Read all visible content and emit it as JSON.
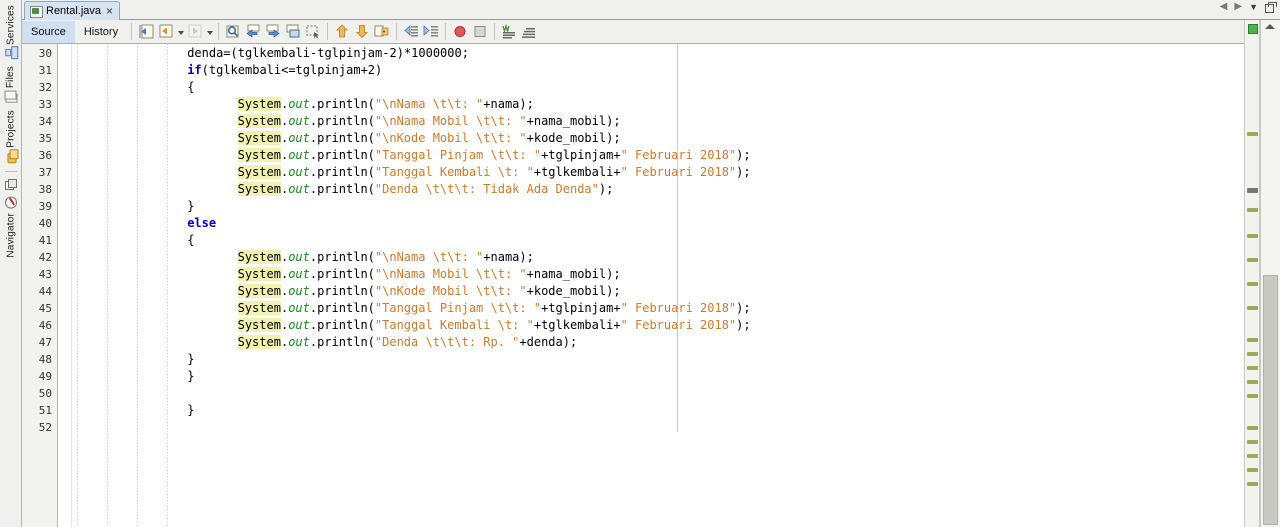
{
  "window": {
    "tab_label": "Rental.java",
    "tab_icon": "java-file-icon",
    "close_label": "×"
  },
  "tabnav": {
    "prev": "◀",
    "next": "▶",
    "list": "▼",
    "maximize_name": "maximize-button"
  },
  "editor_tabs": [
    {
      "label": "Source",
      "active": true
    },
    {
      "label": "History",
      "active": false
    }
  ],
  "toolbar": {
    "buttons": [
      {
        "name": "last-edit-button",
        "icon": "back-edit-icon"
      },
      {
        "name": "go-back-button",
        "icon": "navigate-back-icon"
      },
      {
        "name": "go-forward-button",
        "icon": "navigate-forward-icon"
      },
      {
        "name": "find-selection-button",
        "icon": "magnifier-icon"
      },
      {
        "name": "find-previous-button",
        "icon": "arrow-left-blue-icon"
      },
      {
        "name": "find-next-button",
        "icon": "arrow-right-blue-icon"
      },
      {
        "name": "toggle-highlight-button",
        "icon": "highlight-search-icon"
      },
      {
        "name": "toggle-rectangular-selection-button",
        "icon": "rect-select-icon"
      },
      {
        "name": "previous-bookmark-button",
        "icon": "arrow-up-orange-icon"
      },
      {
        "name": "next-bookmark-button",
        "icon": "arrow-down-orange-icon"
      },
      {
        "name": "toggle-bookmark-button",
        "icon": "bookmark-tag-icon"
      },
      {
        "name": "shift-left-button",
        "icon": "shift-line-left-icon"
      },
      {
        "name": "shift-right-button",
        "icon": "shift-line-right-icon"
      },
      {
        "name": "toggle-breakpoint-button",
        "icon": "red-circle-icon"
      },
      {
        "name": "stop-button",
        "icon": "stop-square-icon"
      },
      {
        "name": "inspect-button",
        "icon": "green-bars-icon"
      },
      {
        "name": "comment-button",
        "icon": "gray-bars-icon"
      }
    ]
  },
  "sidebar": {
    "items": [
      {
        "label": "Services",
        "icon": "services-icon"
      },
      {
        "label": "Files",
        "icon": "files-icon"
      },
      {
        "label": "Projects",
        "icon": "projects-icon"
      },
      {
        "label": "Navigator",
        "icon": "navigator-compass-icon"
      }
    ]
  },
  "editor": {
    "first_line": 30,
    "last_line": 52,
    "margin_column": 80,
    "line_numbers": [
      30,
      31,
      32,
      33,
      34,
      35,
      36,
      37,
      38,
      39,
      40,
      41,
      42,
      43,
      44,
      45,
      46,
      47,
      48,
      49,
      50,
      51,
      52
    ],
    "code_lines": [
      {
        "n": 30,
        "indent": 16,
        "parts": [
          {
            "t": "denda=(tglkembali-tglpinjam-2)*1000000;",
            "c": "plain"
          }
        ]
      },
      {
        "n": 31,
        "indent": 16,
        "parts": [
          {
            "t": "if",
            "c": "kw"
          },
          {
            "t": "(tglkembali<=tglpinjam+2)",
            "c": "plain"
          }
        ]
      },
      {
        "n": 32,
        "indent": 16,
        "parts": [
          {
            "t": "{",
            "c": "plain"
          }
        ]
      },
      {
        "n": 33,
        "indent": 23,
        "parts": [
          {
            "t": "System",
            "c": "sys"
          },
          {
            "t": ".",
            "c": "plain"
          },
          {
            "t": "out",
            "c": "out"
          },
          {
            "t": ".println(",
            "c": "plain"
          },
          {
            "t": "\"\\nNama \\t\\t: \"",
            "c": "str"
          },
          {
            "t": "+nama);",
            "c": "plain"
          }
        ]
      },
      {
        "n": 34,
        "indent": 23,
        "parts": [
          {
            "t": "System",
            "c": "sys"
          },
          {
            "t": ".",
            "c": "plain"
          },
          {
            "t": "out",
            "c": "out"
          },
          {
            "t": ".println(",
            "c": "plain"
          },
          {
            "t": "\"\\nNama Mobil \\t\\t: \"",
            "c": "str"
          },
          {
            "t": "+nama_mobil);",
            "c": "plain"
          }
        ]
      },
      {
        "n": 35,
        "indent": 23,
        "parts": [
          {
            "t": "System",
            "c": "sys"
          },
          {
            "t": ".",
            "c": "plain"
          },
          {
            "t": "out",
            "c": "out"
          },
          {
            "t": ".println(",
            "c": "plain"
          },
          {
            "t": "\"\\nKode Mobil \\t\\t: \"",
            "c": "str"
          },
          {
            "t": "+kode_mobil);",
            "c": "plain"
          }
        ]
      },
      {
        "n": 36,
        "indent": 23,
        "parts": [
          {
            "t": "System",
            "c": "sys"
          },
          {
            "t": ".",
            "c": "plain"
          },
          {
            "t": "out",
            "c": "out"
          },
          {
            "t": ".println(",
            "c": "plain"
          },
          {
            "t": "\"Tanggal Pinjam \\t\\t: \"",
            "c": "str"
          },
          {
            "t": "+tglpinjam+",
            "c": "plain"
          },
          {
            "t": "\" Februari 2018\"",
            "c": "str"
          },
          {
            "t": ");",
            "c": "plain"
          }
        ]
      },
      {
        "n": 37,
        "indent": 23,
        "parts": [
          {
            "t": "System",
            "c": "sys"
          },
          {
            "t": ".",
            "c": "plain"
          },
          {
            "t": "out",
            "c": "out"
          },
          {
            "t": ".println(",
            "c": "plain"
          },
          {
            "t": "\"Tanggal Kembali \\t: \"",
            "c": "str"
          },
          {
            "t": "+tglkembali+",
            "c": "plain"
          },
          {
            "t": "\" Februari 2018\"",
            "c": "str"
          },
          {
            "t": ");",
            "c": "plain"
          }
        ]
      },
      {
        "n": 38,
        "indent": 23,
        "parts": [
          {
            "t": "System",
            "c": "sys"
          },
          {
            "t": ".",
            "c": "plain"
          },
          {
            "t": "out",
            "c": "out"
          },
          {
            "t": ".println(",
            "c": "plain"
          },
          {
            "t": "\"Denda \\t\\t\\t: Tidak Ada Denda\"",
            "c": "str"
          },
          {
            "t": ");",
            "c": "plain"
          }
        ]
      },
      {
        "n": 39,
        "indent": 16,
        "parts": [
          {
            "t": "}",
            "c": "plain"
          }
        ]
      },
      {
        "n": 40,
        "indent": 16,
        "parts": [
          {
            "t": "else",
            "c": "kw"
          }
        ]
      },
      {
        "n": 41,
        "indent": 16,
        "parts": [
          {
            "t": "{",
            "c": "plain"
          }
        ]
      },
      {
        "n": 42,
        "indent": 23,
        "parts": [
          {
            "t": "System",
            "c": "sys"
          },
          {
            "t": ".",
            "c": "plain"
          },
          {
            "t": "out",
            "c": "out"
          },
          {
            "t": ".println(",
            "c": "plain"
          },
          {
            "t": "\"\\nNama \\t\\t: \"",
            "c": "str"
          },
          {
            "t": "+nama);",
            "c": "plain"
          }
        ]
      },
      {
        "n": 43,
        "indent": 23,
        "parts": [
          {
            "t": "System",
            "c": "sys"
          },
          {
            "t": ".",
            "c": "plain"
          },
          {
            "t": "out",
            "c": "out"
          },
          {
            "t": ".println(",
            "c": "plain"
          },
          {
            "t": "\"\\nNama Mobil \\t\\t: \"",
            "c": "str"
          },
          {
            "t": "+nama_mobil);",
            "c": "plain"
          }
        ]
      },
      {
        "n": 44,
        "indent": 23,
        "parts": [
          {
            "t": "System",
            "c": "sys"
          },
          {
            "t": ".",
            "c": "plain"
          },
          {
            "t": "out",
            "c": "out"
          },
          {
            "t": ".println(",
            "c": "plain"
          },
          {
            "t": "\"\\nKode Mobil \\t\\t: \"",
            "c": "str"
          },
          {
            "t": "+kode_mobil);",
            "c": "plain"
          }
        ]
      },
      {
        "n": 45,
        "indent": 23,
        "parts": [
          {
            "t": "System",
            "c": "sys"
          },
          {
            "t": ".",
            "c": "plain"
          },
          {
            "t": "out",
            "c": "out"
          },
          {
            "t": ".println(",
            "c": "plain"
          },
          {
            "t": "\"Tanggal Pinjam \\t\\t: \"",
            "c": "str"
          },
          {
            "t": "+tglpinjam+",
            "c": "plain"
          },
          {
            "t": "\" Februari 2018\"",
            "c": "str"
          },
          {
            "t": ");",
            "c": "plain"
          }
        ]
      },
      {
        "n": 46,
        "indent": 23,
        "parts": [
          {
            "t": "System",
            "c": "sys"
          },
          {
            "t": ".",
            "c": "plain"
          },
          {
            "t": "out",
            "c": "out"
          },
          {
            "t": ".println(",
            "c": "plain"
          },
          {
            "t": "\"Tanggal Kembali \\t: \"",
            "c": "str"
          },
          {
            "t": "+tglkembali+",
            "c": "plain"
          },
          {
            "t": "\" Februari 2018\"",
            "c": "str"
          },
          {
            "t": ");",
            "c": "plain"
          }
        ]
      },
      {
        "n": 47,
        "indent": 23,
        "parts": [
          {
            "t": "System",
            "c": "sys"
          },
          {
            "t": ".",
            "c": "plain"
          },
          {
            "t": "out",
            "c": "out"
          },
          {
            "t": ".println(",
            "c": "plain"
          },
          {
            "t": "\"Denda \\t\\t\\t: Rp. \"",
            "c": "str"
          },
          {
            "t": "+denda);",
            "c": "plain"
          }
        ]
      },
      {
        "n": 48,
        "indent": 16,
        "parts": [
          {
            "t": "}",
            "c": "plain"
          }
        ]
      },
      {
        "n": 49,
        "indent": 16,
        "parts": [
          {
            "t": "}",
            "c": "plain"
          }
        ]
      },
      {
        "n": 50,
        "indent": 0,
        "parts": []
      },
      {
        "n": 51,
        "indent": 16,
        "parts": [
          {
            "t": "}",
            "c": "plain"
          }
        ]
      },
      {
        "n": 52,
        "indent": 0,
        "parts": []
      }
    ]
  },
  "annotations": {
    "status": "ok",
    "status_color": "#4caf50",
    "mark_color": "#9aa85a",
    "marks_y": [
      112,
      188,
      214,
      238,
      262,
      286,
      318,
      332,
      346,
      360,
      374,
      406,
      420,
      434,
      448,
      462
    ]
  },
  "colors": {
    "keyword": "#0000cc",
    "string": "#cc7a29",
    "field": "#1a8a1a",
    "highlight": "#f2f2b0",
    "margin_line": "#f3b9b9",
    "tab_active": "#d6e4f2"
  }
}
